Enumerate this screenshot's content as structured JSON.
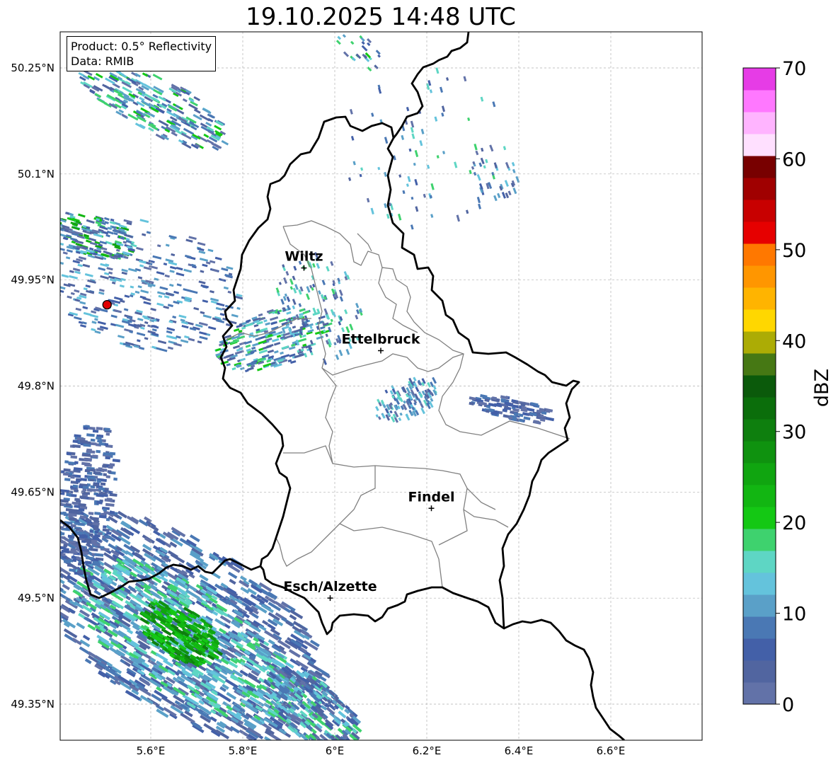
{
  "title": "19.10.2025 14:48 UTC",
  "info": {
    "product": "Product: 0.5° Reflectivity",
    "data": "Data: RMIB"
  },
  "map": {
    "lat_ticks": [
      "50.25°N",
      "50.1°N",
      "49.95°N",
      "49.8°N",
      "49.65°N",
      "49.5°N",
      "49.35°N"
    ],
    "lat_values": [
      50.25,
      50.1,
      49.95,
      49.8,
      49.65,
      49.5,
      49.35
    ],
    "lon_ticks": [
      "5.6°E",
      "5.8°E",
      "6°E",
      "6.2°E",
      "6.4°E",
      "6.6°E"
    ],
    "lon_values": [
      5.6,
      5.8,
      6.0,
      6.2,
      6.4,
      6.6
    ],
    "lon_range": [
      5.4,
      6.8
    ],
    "lat_range": [
      49.3,
      50.3
    ],
    "grid": true,
    "cities": [
      {
        "name": "Wiltz",
        "lon": 5.933,
        "lat": 49.967
      },
      {
        "name": "Ettelbruck",
        "lon": 6.1,
        "lat": 49.85
      },
      {
        "name": "Findel",
        "lon": 6.21,
        "lat": 49.627
      },
      {
        "name": "Esch/Alzette",
        "lon": 5.99,
        "lat": 49.5
      }
    ],
    "radar_site": {
      "lon": 5.505,
      "lat": 49.915
    }
  },
  "colorbar": {
    "label": "dBZ",
    "ticks": [
      "0",
      "10",
      "20",
      "30",
      "40",
      "50",
      "60",
      "70"
    ],
    "range": [
      0,
      70
    ],
    "colors": [
      "#6272a8",
      "#5165a0",
      "#4360a8",
      "#4a78b4",
      "#5aa0c8",
      "#64c3dc",
      "#5ed6c4",
      "#3ed26e",
      "#14c814",
      "#12b612",
      "#10a510",
      "#0f920f",
      "#0e7f0e",
      "#0b6e0b",
      "#0b5a0b",
      "#467814",
      "#acac05",
      "#ffd700",
      "#ffb400",
      "#ff9600",
      "#ff7800",
      "#e60000",
      "#c80000",
      "#a00000",
      "#780000",
      "#ffe0ff",
      "#ffb4ff",
      "#ff78ff",
      "#e63ce6"
    ]
  }
}
